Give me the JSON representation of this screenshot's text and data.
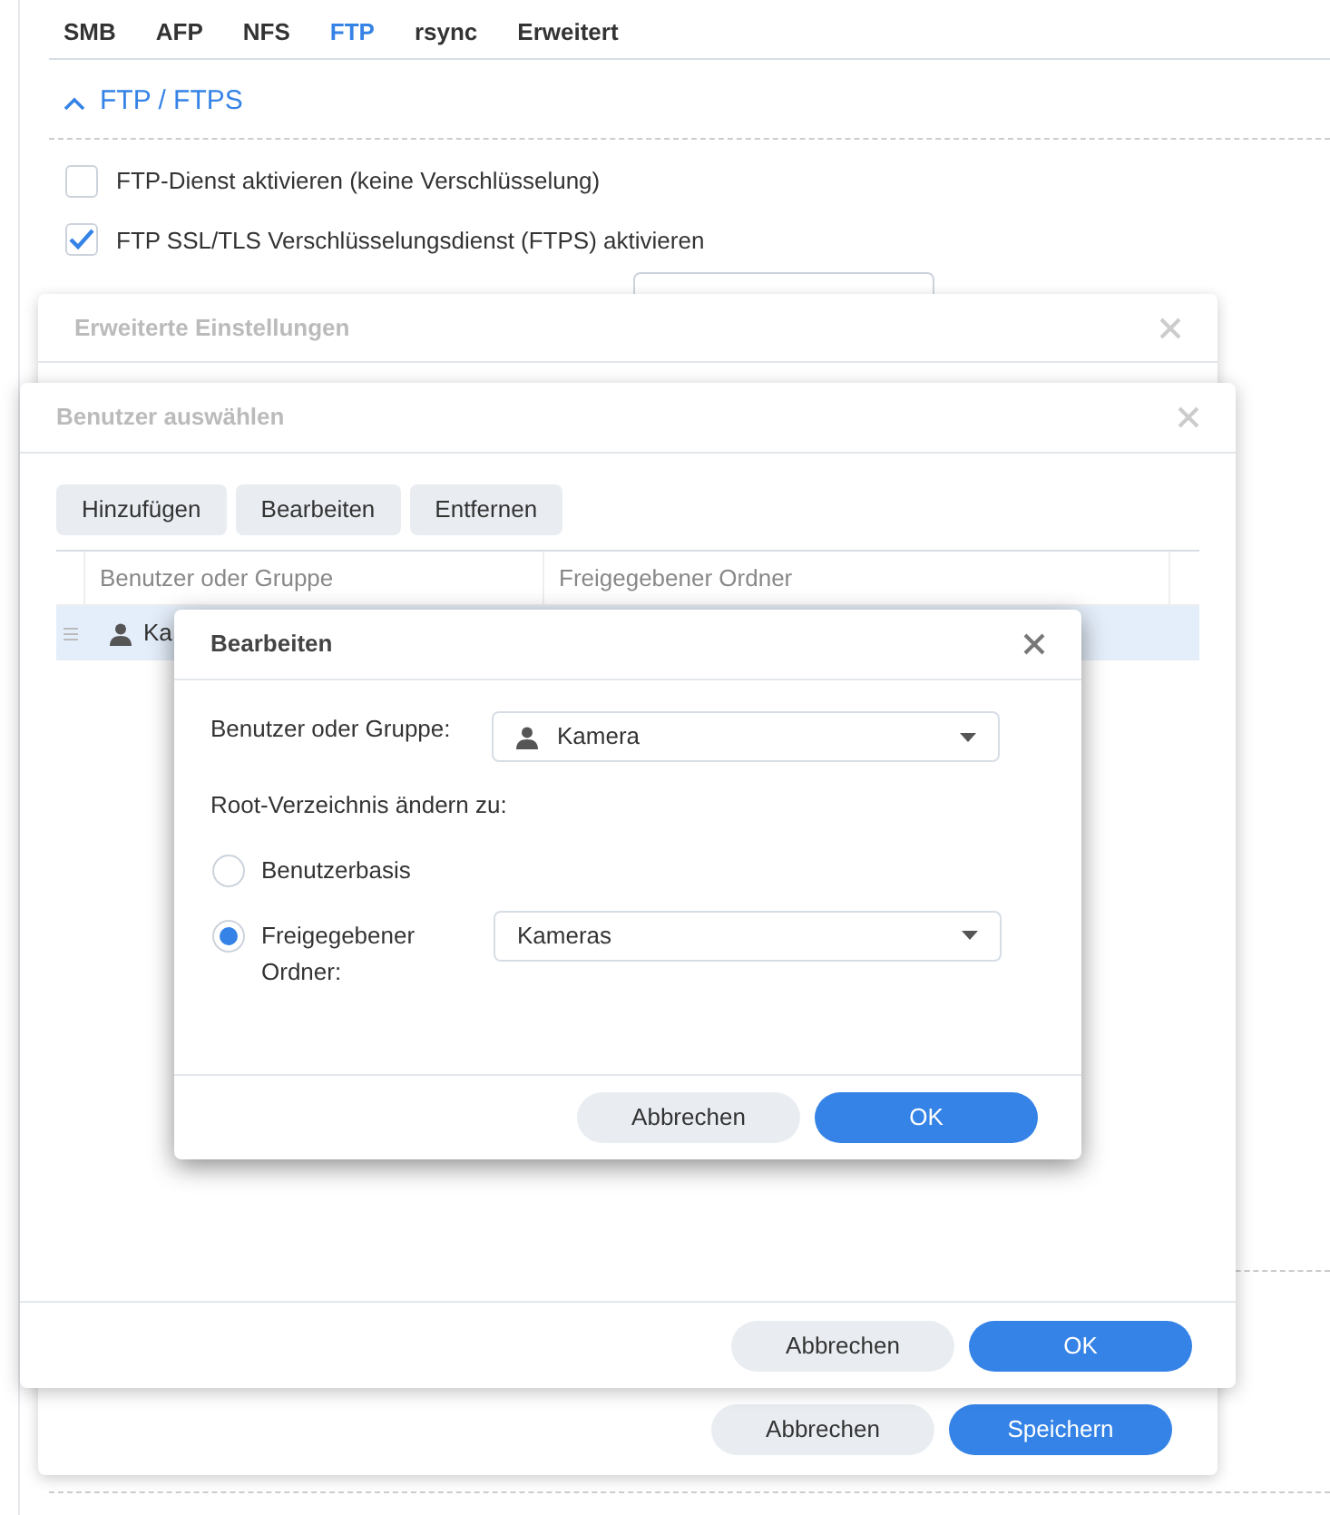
{
  "tabs": [
    {
      "label": "SMB",
      "selected": false
    },
    {
      "label": "AFP",
      "selected": false
    },
    {
      "label": "NFS",
      "selected": false
    },
    {
      "label": "FTP",
      "selected": true
    },
    {
      "label": "rsync",
      "selected": false
    },
    {
      "label": "Erweitert",
      "selected": false
    }
  ],
  "section": {
    "title": "FTP / FTPS",
    "expanded": true
  },
  "options": [
    {
      "label": "FTP-Dienst aktivieren (keine Verschlüsselung)",
      "checked": false
    },
    {
      "label": "FTP SSL/TLS Verschlüsselungsdienst (FTPS) aktivieren",
      "checked": true
    }
  ],
  "advanced_dialog": {
    "title": "Erweiterte Einstellungen",
    "buttons": [
      {
        "label": "Abbrechen",
        "primary": false
      },
      {
        "label": "Speichern",
        "primary": true
      }
    ]
  },
  "user_dialog": {
    "title": "Benutzer auswählen",
    "toolbar": [
      "Hinzufügen",
      "Bearbeiten",
      "Entfernen"
    ],
    "columns": [
      "Benutzer oder Gruppe",
      "Freigegebener Ordner"
    ],
    "rows": [
      {
        "user": "Ka",
        "selected": true
      }
    ],
    "buttons": [
      {
        "label": "Abbrechen",
        "primary": false
      },
      {
        "label": "OK",
        "primary": true
      }
    ]
  },
  "edit_dialog": {
    "title": "Bearbeiten",
    "user_label": "Benutzer oder Gruppe:",
    "user_value": "Kamera",
    "root_label": "Root-Verzeichnis ändern zu:",
    "root_options": [
      {
        "label": "Benutzerbasis",
        "selected": false
      },
      {
        "label": "Freigegebener Ordner:",
        "selected": true,
        "value": "Kameras"
      }
    ],
    "buttons": [
      {
        "label": "Abbrechen",
        "primary": false
      },
      {
        "label": "OK",
        "primary": true
      }
    ]
  }
}
